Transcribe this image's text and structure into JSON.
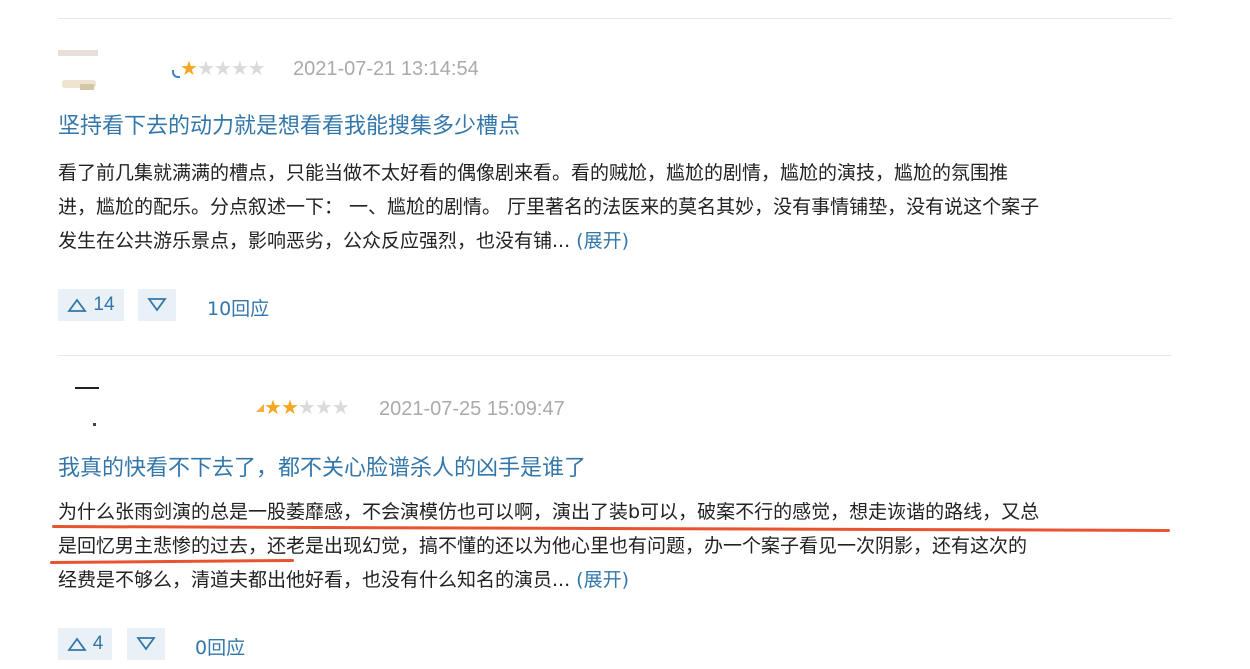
{
  "reviews": [
    {
      "stars_filled": 1,
      "stars_total": 5,
      "time": "2021-07-21 13:14:54",
      "title": "坚持看下去的动力就是想看看我能搜集多少槽点",
      "body_lines": [
        "看了前几集就满满的槽点，只能当做不太好看的偶像剧来看。看的贼尬，尴尬的剧情，尴尬的演技，尴尬的氛围推",
        "进，尴尬的配乐。分点叙述一下： 一、尴尬的剧情。 厅里著名的法医来的莫名其妙，没有事情铺垫，没有说这个案子",
        "发生在公共游乐景点，影响恶劣，公众反应强烈，也没有铺..."
      ],
      "expand_label": "展开",
      "up_count": "14",
      "reply_label": "10回应"
    },
    {
      "stars_filled": 2,
      "stars_total": 5,
      "time": "2021-07-25 15:09:47",
      "title": "我真的快看不下去了，都不关心脸谱杀人的凶手是谁了",
      "body_lines": [
        "为什么张雨剑演的总是一股萎靡感，不会演模仿也可以啊，演出了装b可以，破案不行的感觉，想走诙谐的路线，又总",
        "是回忆男主悲惨的过去，还老是出现幻觉，搞不懂的还以为他心里也有问题，办一个案子看见一次阴影，还有这次的",
        "经费是不够么，清道夫都出他好看，也没有什么知名的演员..."
      ],
      "expand_label": "展开",
      "up_count": "4",
      "reply_label": "0回应"
    }
  ],
  "colors": {
    "link": "#3377aa",
    "star_on": "#f5a623",
    "star_off": "#dadada",
    "underline": "#e8542f"
  },
  "icons": {
    "up": "triangle-up-icon",
    "down": "triangle-down-icon",
    "star": "star-icon"
  }
}
